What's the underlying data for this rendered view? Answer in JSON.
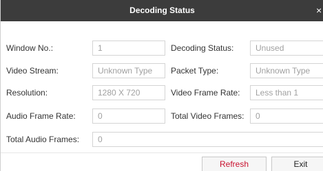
{
  "dialog": {
    "title": "Decoding Status",
    "close_glyph": "×"
  },
  "fields": {
    "window_no": {
      "label": "Window No.:",
      "value": "1"
    },
    "decoding_status": {
      "label": "Decoding Status:",
      "value": "Unused"
    },
    "video_stream": {
      "label": "Video Stream:",
      "value": "Unknown Type"
    },
    "packet_type": {
      "label": "Packet Type:",
      "value": "Unknown Type"
    },
    "resolution": {
      "label": "Resolution:",
      "value": "1280 X 720"
    },
    "video_frame_rate": {
      "label": "Video Frame Rate:",
      "value": "Less than 1"
    },
    "audio_frame_rate": {
      "label": "Audio Frame Rate:",
      "value": "0"
    },
    "total_video_frames": {
      "label": "Total Video Frames:",
      "value": "0"
    },
    "total_audio_frames": {
      "label": "Total Audio Frames:",
      "value": "0"
    }
  },
  "buttons": {
    "refresh": "Refresh",
    "exit": "Exit"
  },
  "colors": {
    "titlebar": "#3c3c3c",
    "refresh_text": "#c8102e"
  }
}
